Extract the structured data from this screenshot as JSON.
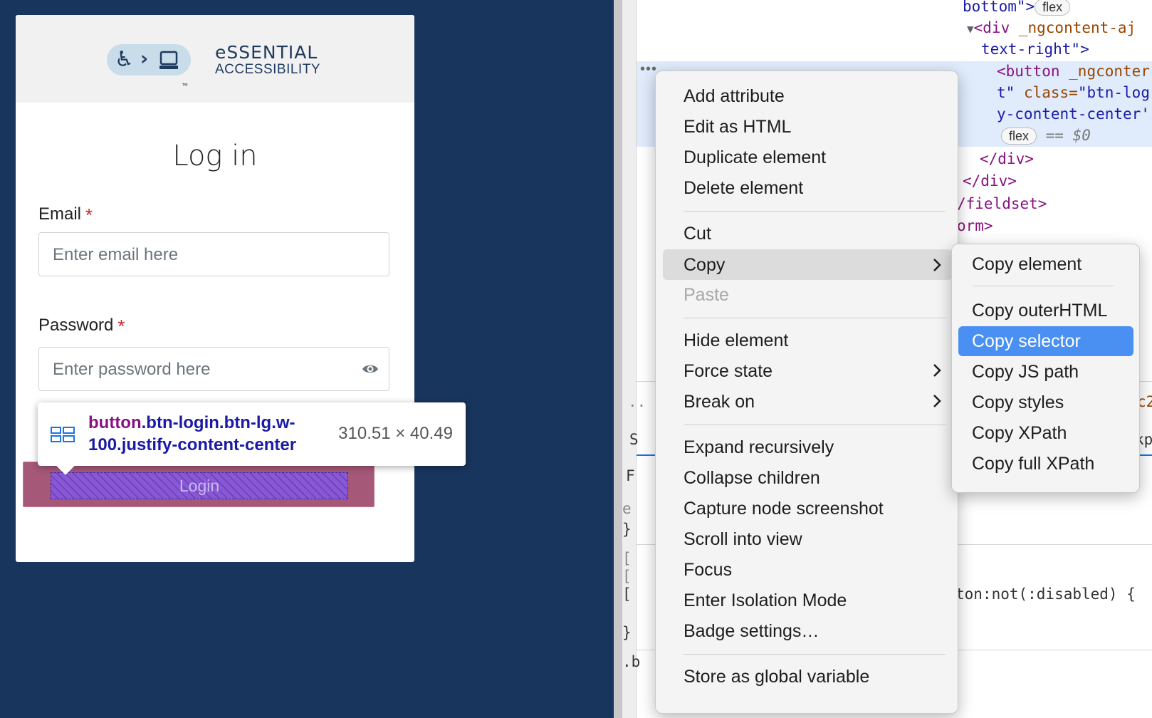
{
  "login": {
    "brand_line1": "eSSENTIAL",
    "brand_line2": "ACCESSIBILITY",
    "brand_trademark": "™",
    "title": "Log in",
    "email_label": "Email",
    "email_placeholder": "Enter email here",
    "password_label": "Password",
    "password_placeholder": "Enter password here",
    "required_mark": "*",
    "button_label": "Login"
  },
  "inspect_tooltip": {
    "tag": "button",
    "classes": ".btn-login.btn-lg.w-100.justify-content-center",
    "size": "310.51 × 40.49"
  },
  "devtools": {
    "lines": {
      "l1_a": "bottom\">",
      "l1_badge": "flex",
      "l2_tag": "<div",
      "l2_attr": " _ngcontent-aj",
      "l3": "text-right\">",
      "l4_tag": "<button",
      "l4_attr": " _ngconter",
      "l5_a": "t\"",
      "l5_attr": " class=",
      "l5_val": "\"btn-log",
      "l6": "y-content-center'",
      "l7_badge": "flex",
      "l7_rest": " == $0",
      "l8": "</div>",
      "l9": "</div>",
      "l10": "/fieldset>",
      "l11": "orm>"
    },
    "fragments": {
      "f1": "..",
      "f2": "c2",
      "f3": "S",
      "f4": "kp",
      "f5": "F",
      "f6": "e",
      "f7": "}",
      "f8": "[",
      "f9": "[",
      "f10": "[",
      "f11": "ton:not(:disabled) {",
      "f12": "}",
      "f13": ".b"
    }
  },
  "context_menu": {
    "items": [
      "Add attribute",
      "Edit as HTML",
      "Duplicate element",
      "Delete element",
      "Cut",
      "Copy",
      "Paste",
      "Hide element",
      "Force state",
      "Break on",
      "Expand recursively",
      "Collapse children",
      "Capture node screenshot",
      "Scroll into view",
      "Focus",
      "Enter Isolation Mode",
      "Badge settings…",
      "Store as global variable"
    ]
  },
  "copy_submenu": {
    "items": [
      "Copy element",
      "Copy outerHTML",
      "Copy selector",
      "Copy JS path",
      "Copy styles",
      "Copy XPath",
      "Copy full XPath"
    ],
    "active": "Copy selector"
  },
  "colors": {
    "page_bg": "#18355e",
    "highlight_blue": "#4a90f2",
    "selection_row": "#e0ebfb"
  }
}
